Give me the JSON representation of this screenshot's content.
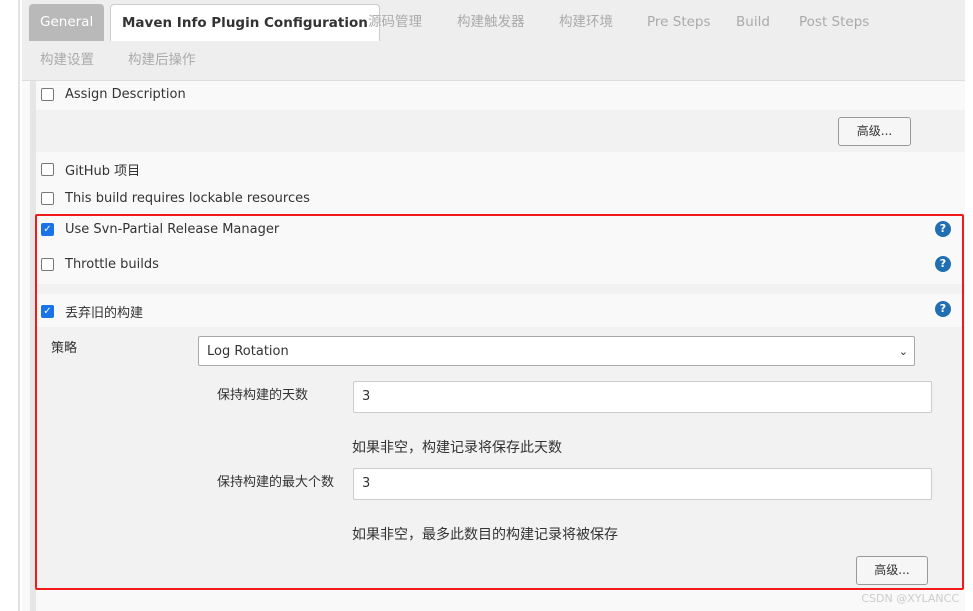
{
  "tabs": [
    "General",
    "Maven Info Plugin Configuration",
    "源码管理",
    "构建触发器",
    "构建环境",
    "Pre Steps",
    "Build",
    "Post Steps",
    "构建设置",
    "构建后操作"
  ],
  "options": {
    "assign_description": "Assign Description",
    "advanced": "高级...",
    "github": "GitHub 项目",
    "lockable": "This build requires lockable resources",
    "svn_partial": "Use Svn-Partial Release Manager",
    "throttle": "Throttle builds",
    "discard": "丢弃旧的构建"
  },
  "discard": {
    "strategy_label": "策略",
    "strategy_value": "Log Rotation",
    "days_label": "保持构建的天数",
    "days_value": "3",
    "days_hint": "如果非空，构建记录将保存此天数",
    "max_label": "保持构建的最大个数",
    "max_value": "3",
    "max_hint": "如果非空，最多此数目的构建记录将被保存",
    "advanced": "高级..."
  },
  "help_glyph": "?",
  "watermark": "CSDN @XYLANCC"
}
